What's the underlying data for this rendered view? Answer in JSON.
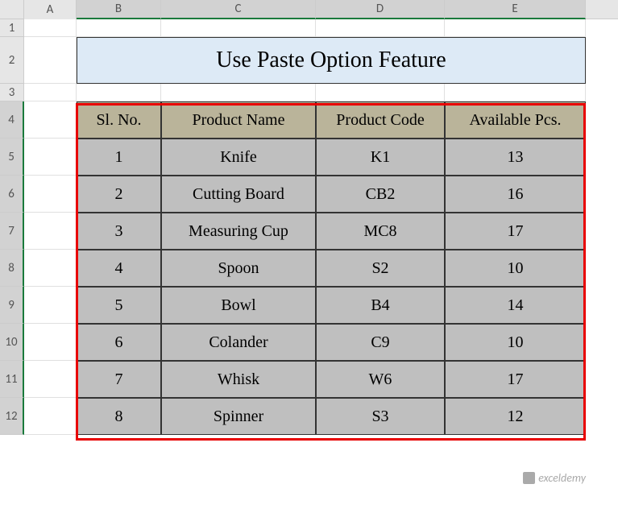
{
  "columns": {
    "A": "A",
    "B": "B",
    "C": "C",
    "D": "D",
    "E": "E"
  },
  "rows": {
    "r1": "1",
    "r2": "2",
    "r3": "3",
    "r4": "4",
    "r5": "5",
    "r6": "6",
    "r7": "7",
    "r8": "8",
    "r9": "9",
    "r10": "10",
    "r11": "11",
    "r12": "12"
  },
  "title": "Use Paste Option Feature",
  "headers": {
    "sl": "Sl. No.",
    "product_name": "Product Name",
    "product_code": "Product Code",
    "available": "Available Pcs."
  },
  "data": [
    {
      "sl": "1",
      "name": "Knife",
      "code": "K1",
      "pcs": "13"
    },
    {
      "sl": "2",
      "name": "Cutting Board",
      "code": "CB2",
      "pcs": "16"
    },
    {
      "sl": "3",
      "name": "Measuring Cup",
      "code": "MC8",
      "pcs": "17"
    },
    {
      "sl": "4",
      "name": "Spoon",
      "code": "S2",
      "pcs": "10"
    },
    {
      "sl": "5",
      "name": "Bowl",
      "code": "B4",
      "pcs": "14"
    },
    {
      "sl": "6",
      "name": "Colander",
      "code": "C9",
      "pcs": "10"
    },
    {
      "sl": "7",
      "name": "Whisk",
      "code": "W6",
      "pcs": "17"
    },
    {
      "sl": "8",
      "name": "Spinner",
      "code": "S3",
      "pcs": "12"
    }
  ],
  "watermark": "exceldemy",
  "chart_data": {
    "type": "table",
    "title": "Use Paste Option Feature",
    "columns": [
      "Sl. No.",
      "Product Name",
      "Product Code",
      "Available Pcs."
    ],
    "rows": [
      [
        "1",
        "Knife",
        "K1",
        13
      ],
      [
        "2",
        "Cutting Board",
        "CB2",
        16
      ],
      [
        "3",
        "Measuring Cup",
        "MC8",
        17
      ],
      [
        "4",
        "Spoon",
        "S2",
        10
      ],
      [
        "5",
        "Bowl",
        "B4",
        14
      ],
      [
        "6",
        "Colander",
        "C9",
        10
      ],
      [
        "7",
        "Whisk",
        "W6",
        17
      ],
      [
        "8",
        "Spinner",
        "S3",
        12
      ]
    ]
  }
}
